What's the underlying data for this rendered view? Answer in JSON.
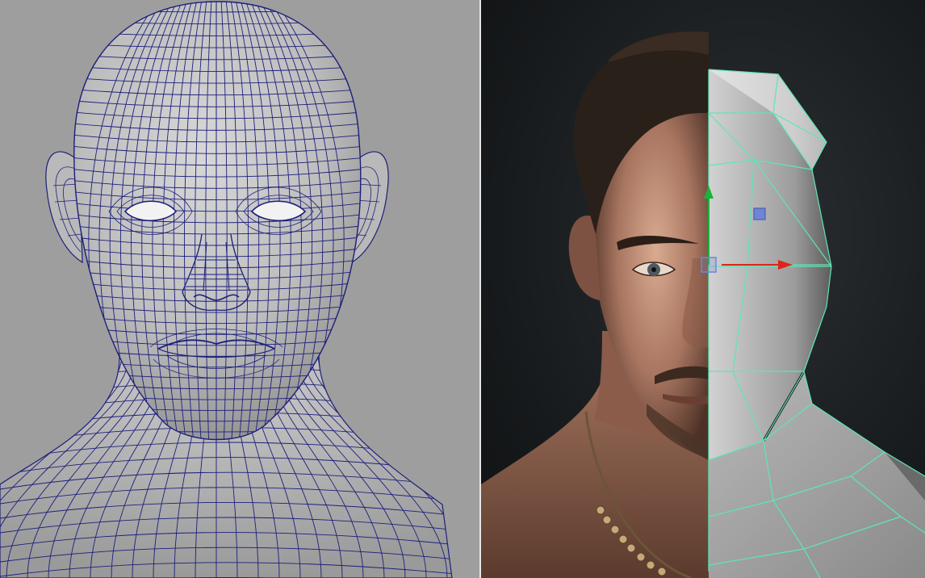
{
  "viewports": {
    "left": {
      "view_mode": "wireframe-on-shaded",
      "model": "head-base-mesh"
    },
    "right": {
      "view_mode": "textured-split",
      "model": "realistic-male-head-with-lowpoly-overlay"
    }
  },
  "colors": {
    "left_background": "#9e9e9e",
    "wireframe": "#1c1f7a",
    "right_background": "#16191b",
    "selection_wireframe": "#5fe6b4",
    "gizmo_x_axis": "#e0241c",
    "gizmo_y_axis": "#19b33a",
    "gizmo_handle": "#6f86d6"
  },
  "icons": [
    "move-gizmo-icon",
    "y-axis-arrow-icon",
    "x-axis-arrow-icon",
    "center-handle-icon",
    "vertex-handle-icon"
  ]
}
